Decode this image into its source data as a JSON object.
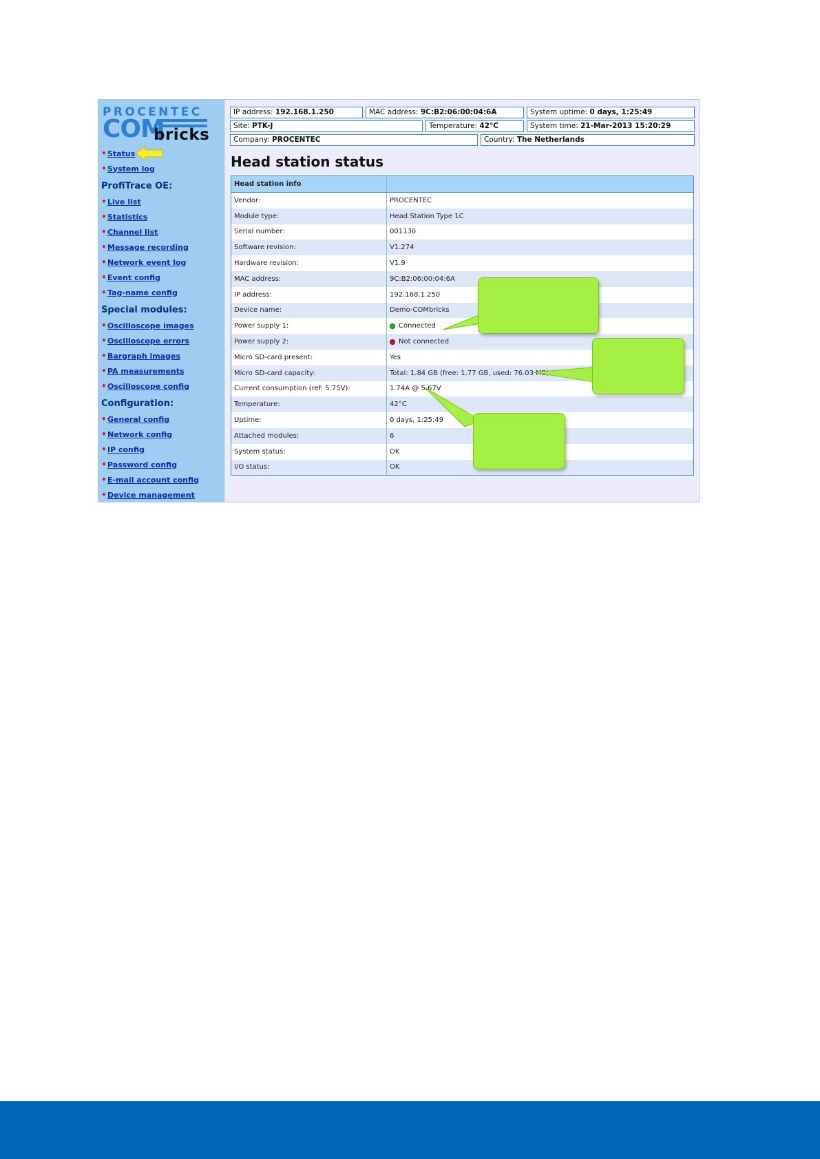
{
  "logo": {
    "line1": "PROCENTEC",
    "line2": "COM",
    "line3": "bricks"
  },
  "nav": {
    "top_items": [
      "Status",
      "System log"
    ],
    "sections": [
      {
        "title": "ProfiTrace OE:",
        "items": [
          "Live list",
          "Statistics",
          "Channel list",
          "Message recording",
          "Network event log",
          "Event config",
          "Tag-name config"
        ]
      },
      {
        "title": "Special modules:",
        "items": [
          "Oscilloscope images",
          "Oscilloscope errors",
          "Bargraph images",
          "PA measurements",
          "Oscilloscope config"
        ]
      },
      {
        "title": "Configuration:",
        "items": [
          "General config",
          "Network config",
          "IP config",
          "Password config",
          "E-mail account config",
          "Device management"
        ]
      }
    ]
  },
  "header": {
    "ip_label": "IP address:",
    "ip_value": "192.168.1.250",
    "mac_label": "MAC address:",
    "mac_value": "9C:B2:06:00:04:6A",
    "uptime_label": "System uptime:",
    "uptime_value": "0 days, 1:25:49",
    "site_label": "Site:",
    "site_value": "PTK-J",
    "temp_label": "Temperature:",
    "temp_value": "42°C",
    "time_label": "System time:",
    "time_value": "21-Mar-2013 15:20:29",
    "company_label": "Company:",
    "company_value": "PROCENTEC",
    "country_label": "Country:",
    "country_value": "The Netherlands"
  },
  "page_title": "Head station status",
  "table": {
    "header": "Head station info",
    "rows": [
      {
        "label": "Vendor:",
        "value": "PROCENTEC"
      },
      {
        "label": "Module type:",
        "value": "Head Station Type 1C"
      },
      {
        "label": "Serial number:",
        "value": "001130"
      },
      {
        "label": "Software revision:",
        "value": "V1.274"
      },
      {
        "label": "Hardware revision:",
        "value": "V1.9"
      },
      {
        "label": "MAC address:",
        "value": "9C:B2:06:00:04:6A"
      },
      {
        "label": "IP address:",
        "value": "192.168.1.250"
      },
      {
        "label": "Device name:",
        "value": "Demo-COMbricks"
      },
      {
        "label": "Power supply 1:",
        "value": "Connected",
        "dot": "#19b519"
      },
      {
        "label": "Power supply 2:",
        "value": "Not connected",
        "dot": "#c41a1a"
      },
      {
        "label": "Micro SD-card present:",
        "value": "Yes"
      },
      {
        "label": "Micro SD-card capacity:",
        "value": "Total: 1.84 GB (free: 1.77 GB, used: 76.03 MB)"
      },
      {
        "label": "Current consumption (ref: 5.75V):",
        "value": "1.74A @ 5.67V"
      },
      {
        "label": "Temperature:",
        "value": "42°C"
      },
      {
        "label": "Uptime:",
        "value": "0 days, 1:25:49"
      },
      {
        "label": "Attached modules:",
        "value": "6"
      },
      {
        "label": "System status:",
        "value": "OK"
      },
      {
        "label": "I/O status:",
        "value": "OK"
      }
    ]
  },
  "colors": {
    "sidebar": "#9dcdf1",
    "table_header": "#a8d5f7",
    "callout": "#a6f043",
    "footer": "#0067b8",
    "highlight_arrow": "#f7f032"
  }
}
